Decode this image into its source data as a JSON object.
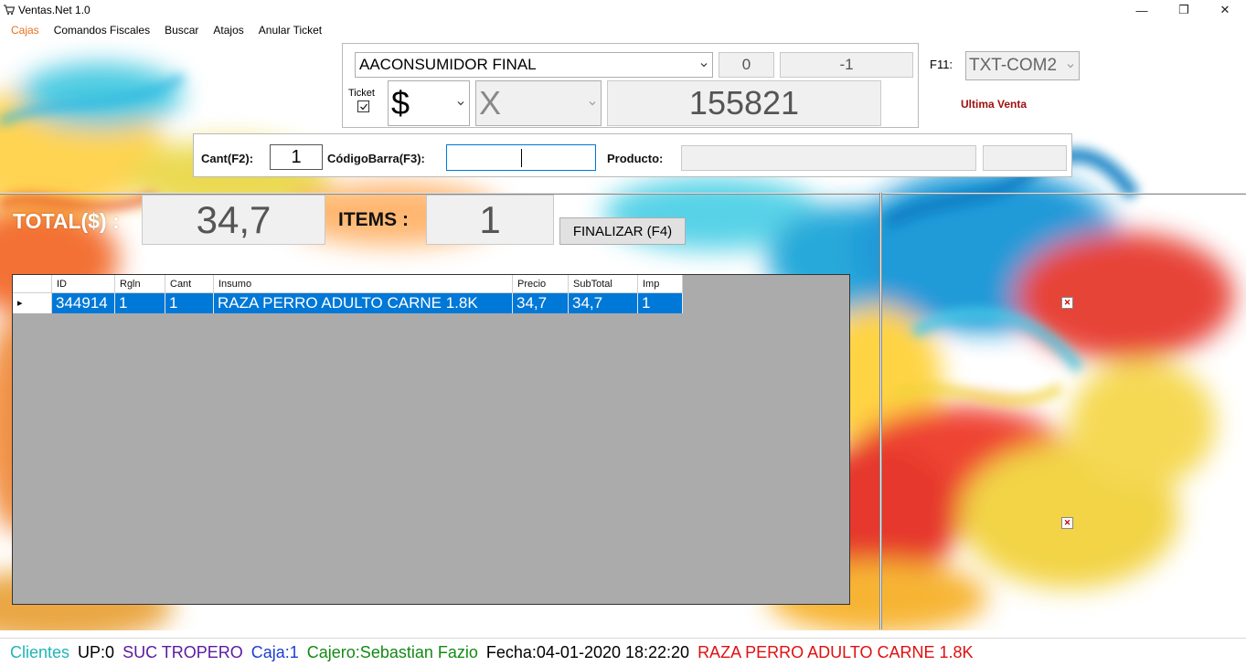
{
  "window": {
    "title": "Ventas.Net 1.0",
    "minimize_glyph": "—",
    "maximize_glyph": "❐",
    "close_glyph": "✕"
  },
  "menu": {
    "items": [
      "Cajas",
      "Comandos Fiscales",
      "Buscar",
      "Atajos",
      "Anular Ticket"
    ]
  },
  "header": {
    "client_select": "AACONSUMIDOR FINAL",
    "field_zero": "0",
    "field_minus_one": "-1",
    "ticket_label": "Ticket",
    "ticket_checked": true,
    "currency_select": "$",
    "type_select": "X",
    "ticket_number": "155821",
    "f11_label": "F11:",
    "port_select": "TXT-COM2",
    "ultima_venta": "Ultima Venta"
  },
  "entry": {
    "cant_label": "Cant(F2):",
    "cant_value": "1",
    "barcode_label": "CódigoBarra(F3):",
    "barcode_value": "",
    "producto_label": "Producto:",
    "producto_value": "",
    "producto_extra": ""
  },
  "totals": {
    "total_label": "TOTAL($) :",
    "total_value": "34,7",
    "items_label": "ITEMS :",
    "items_value": "1",
    "finalize_button": "FINALIZAR (F4)"
  },
  "grid": {
    "columns": [
      "ID",
      "Rgln",
      "Cant",
      "Insumo",
      "Precio",
      "SubTotal",
      "Imp"
    ],
    "rows": [
      [
        "344914",
        "1",
        "1",
        "RAZA PERRO ADULTO CARNE 1.8K",
        "34,7",
        "34,7",
        "1"
      ]
    ],
    "row_marker": "▸"
  },
  "side": {
    "broken_image_glyph": "✕"
  },
  "status": {
    "clientes": "Clientes",
    "up": "UP:0",
    "sucursal": "SUC TROPERO",
    "caja": "Caja:1",
    "cajero": "Cajero:Sebastian Fazio",
    "fecha": "Fecha:04-01-2020 18:22:20",
    "producto": "RAZA PERRO ADULTO CARNE 1.8K",
    "colors": {
      "clientes": "#1fb5b5",
      "up": "#000000",
      "sucursal": "#5b1a9e",
      "caja": "#1a3fd0",
      "cajero": "#138a13",
      "fecha": "#000000",
      "producto": "#e01010"
    }
  },
  "colors": {
    "accent": "#0078d7",
    "menu_active": "#e8701a",
    "ultima_venta": "#a01010",
    "grid_bg": "#ababab"
  }
}
